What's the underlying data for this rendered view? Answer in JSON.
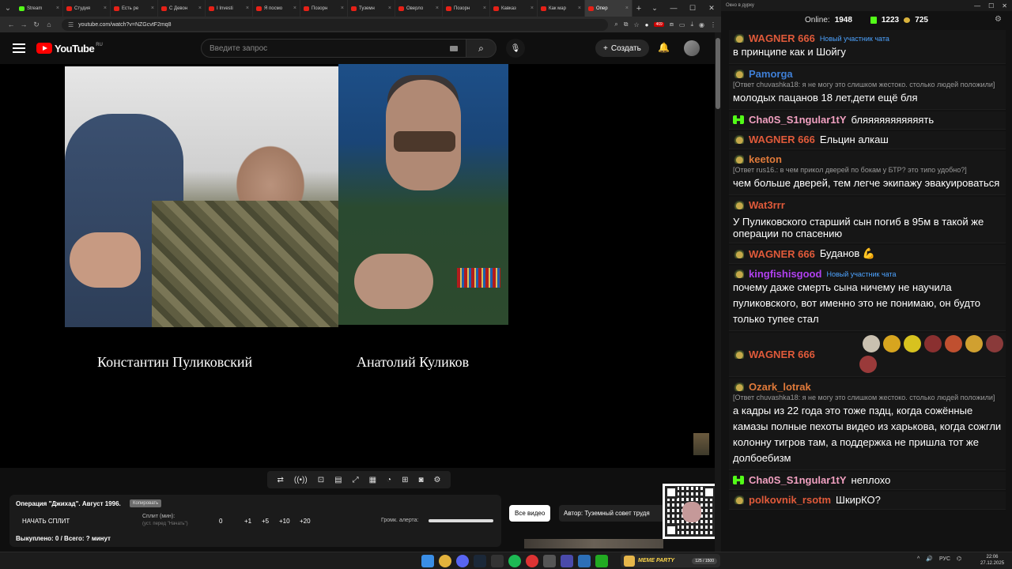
{
  "browser": {
    "tabs": [
      {
        "label": "Stream",
        "active": false,
        "favicon": "kick"
      },
      {
        "label": "Студия",
        "active": false,
        "favicon": "youtube"
      },
      {
        "label": "Есть ре",
        "active": false,
        "favicon": "youtube"
      },
      {
        "label": "С Девон",
        "active": false,
        "favicon": "youtube"
      },
      {
        "label": "I Investi",
        "active": false,
        "favicon": "youtube"
      },
      {
        "label": "Я посмо",
        "active": false,
        "favicon": "youtube"
      },
      {
        "label": "Позорн",
        "active": false,
        "favicon": "youtube"
      },
      {
        "label": "Туземн",
        "active": false,
        "favicon": "youtube"
      },
      {
        "label": "Оверло",
        "active": false,
        "favicon": "youtube"
      },
      {
        "label": "Позорн",
        "active": false,
        "favicon": "youtube"
      },
      {
        "label": "Кавказ",
        "active": false,
        "favicon": "youtube"
      },
      {
        "label": "Как мар",
        "active": false,
        "favicon": "youtube"
      },
      {
        "label": "Опер",
        "active": true,
        "favicon": "youtube"
      }
    ],
    "url": "youtube.com/watch?v=NZGcvtF2mq8",
    "ext_badge": "469"
  },
  "youtube": {
    "logo_text": "YouTube",
    "region": "RU",
    "search_placeholder": "Введите запрос",
    "create_label": "Создать"
  },
  "video": {
    "caption_left": "Константин Пуликовский",
    "caption_right": "Анатолий Куликов"
  },
  "split_panel": {
    "title": "Операция \"Джихад\". Август 1996.",
    "copy_label": "Копировать",
    "start_split": "НАЧАТЬ СПЛИТ",
    "split_label": "Сплит (мин):",
    "split_sub": "(уст. перед \"Начать\")",
    "value": "0",
    "plus1": "+1",
    "plus5": "+5",
    "plus10": "+10",
    "plus20": "+20",
    "alert_label": "Громк. алерта:",
    "alert_volume": 1.0,
    "bought": "Выкуплено: 0 / Всего: ? минут"
  },
  "overlay": {
    "all_videos": "Все видео",
    "author": "Автор: Туземный совет трудя"
  },
  "chat": {
    "window_title": "Окно в дурку",
    "online_label": "Online:",
    "online_count": "1948",
    "kick_count": "1223",
    "coin_count": "725",
    "messages": [
      {
        "user": "WAGNER 666",
        "color": "#e05a3a",
        "badge": "coin",
        "tag": "Новый участник чата",
        "text": "в принципе как и Шойгу"
      },
      {
        "user": "Pamorga",
        "color": "#3f7fd6",
        "badge": "coin",
        "reply": "[Ответ chuvashka18: я не могу это слишком жестоко. столько людей положили]",
        "text": "молодых пацанов 18 лет,дети ещё бля"
      },
      {
        "user": "Cha0S_S1ngular1tY",
        "color": "#f0a0c0",
        "badge": "kick",
        "inline": "бляяяяяяяяяяять"
      },
      {
        "user": "WAGNER 666",
        "color": "#e05a3a",
        "badge": "coin",
        "inline": "Ельцин алкаш"
      },
      {
        "user": "keeton",
        "color": "#e07a3a",
        "badge": "coin",
        "reply": "[Ответ rus16.: в чем прикол дверей по бокам у БТР? это типо удобно?]",
        "text": "чем больше дверей, тем легче экипажу эвакуироваться"
      },
      {
        "user": "Wat3rrr",
        "color": "#e05a3a",
        "badge": "coin",
        "inline": "У Пуликовского старший сын погиб в 95м в такой же операции по спасению"
      },
      {
        "user": "WAGNER 666",
        "color": "#e05a3a",
        "badge": "coin",
        "inline": "Буданов 💪"
      },
      {
        "user": "kingfishisgood",
        "color": "#b040f0",
        "badge": "coin",
        "tag": "Новый участник чата",
        "text": "почему даже смерть сына ничему не научила пуликовского, вот именно это не понимаю, он будто только тупее стал"
      },
      {
        "user": "WAGNER 666",
        "color": "#e05a3a",
        "badge": "coin",
        "emotes": 8
      },
      {
        "user": "Ozark_lotrak",
        "color": "#e07a3a",
        "badge": "coin",
        "reply": "[Ответ chuvashka18: я не могу это слишком жестоко. столько людей положили]",
        "text": "а кадры из 22 года это тоже пздц, когда сожённые камазы полные пехоты видео из харькова, когда сожгли колонну тигров там, а поддержка не пришла тот же долбоебизм"
      },
      {
        "user": "Cha0S_S1ngular1tY",
        "color": "#f0a0c0",
        "badge": "kick",
        "inline": "неплохо"
      },
      {
        "user": "polkovnik_rsotm",
        "color": "#e05a3a",
        "badge": "coin",
        "inline": "ШкирКО?"
      }
    ]
  },
  "taskbar": {
    "meme_title": "MEME PARTY",
    "meme_progress": "125 / 1500",
    "lang": "РУС",
    "time": "22:06",
    "date": "27.12.2025"
  }
}
